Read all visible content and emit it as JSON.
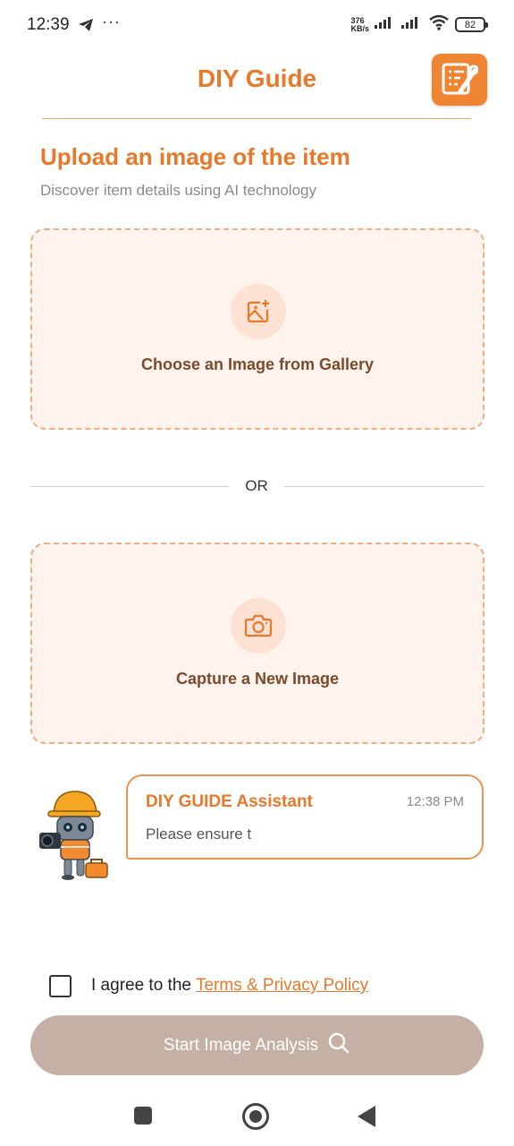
{
  "status_bar": {
    "time": "12:39",
    "dots": "···",
    "speed_value": "376",
    "speed_unit": "KB/s",
    "battery": "82"
  },
  "header": {
    "title": "DIY Guide",
    "logo_icon": "checklist-wrench-icon"
  },
  "section": {
    "title": "Upload an image of the item",
    "subtitle": "Discover item details using AI technology"
  },
  "gallery_card": {
    "icon": "add-image-icon",
    "label": "Choose an Image from Gallery"
  },
  "divider": {
    "label": "OR"
  },
  "camera_card": {
    "icon": "camera-icon",
    "label": "Capture a New Image"
  },
  "assistant": {
    "name": "DIY GUIDE Assistant",
    "time": "12:38 PM",
    "message": "Please ensure t"
  },
  "agreement": {
    "text": "I agree to the",
    "link": "Terms & Privacy Policy",
    "checked": false
  },
  "start_button": {
    "label": "Start Image Analysis",
    "icon": "search-icon"
  },
  "colors": {
    "accent": "#e8782a",
    "card_bg": "#fff3ee",
    "button_disabled": "#c4b0a4"
  }
}
